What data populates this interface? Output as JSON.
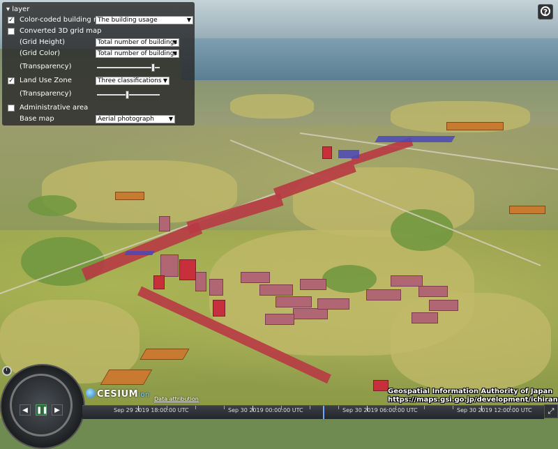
{
  "layer_panel": {
    "title": "layer",
    "rows": [
      {
        "checked": true,
        "label": "Color-coded building map",
        "select": "The building usage"
      },
      {
        "checked": false,
        "label": "Converted 3D grid map"
      },
      {
        "label": "(Grid Height)",
        "select": "Total number of buildings"
      },
      {
        "label": "(Grid Color)",
        "select": "Total number of buildings"
      },
      {
        "label": "(Transparency)",
        "slider": 0.9
      },
      {
        "checked": true,
        "label": "Land Use Zone",
        "select": "Three classifications"
      },
      {
        "label": "(Transparency)",
        "slider": 0.5
      },
      {
        "checked": false,
        "label": "Administrative area"
      },
      {
        "label": "Base map",
        "select": "Aerial photograph"
      }
    ]
  },
  "help_button": {
    "label": "?"
  },
  "branding": {
    "cesium": "CESIUM",
    "cesium_suffix": "ion",
    "attribution_link": "Data attribution"
  },
  "credit": {
    "line1": "Geospatial Information Authority of Japan",
    "line2": "https://maps.gsi.go.jp/development/ichiran.html"
  },
  "timeline": {
    "labels": [
      "Sep 29 2019 18:00:00 UTC",
      "Sep 30 2019 00:00:00 UTC",
      "Sep 30 2019 06:00:00 UTC",
      "Sep 30 2019 12:00:00 UTC"
    ]
  },
  "animation": {
    "back_label": "◀",
    "pause_label": "❚❚",
    "forward_label": "▶"
  },
  "icons": {
    "fullscreen": "fullscreen-icon",
    "clock": "clock-icon"
  },
  "colors": {
    "commercial": "#c7303b",
    "residential": "#b06673",
    "industrial": "#4b48b8",
    "zone_residential": "#b5b860"
  }
}
